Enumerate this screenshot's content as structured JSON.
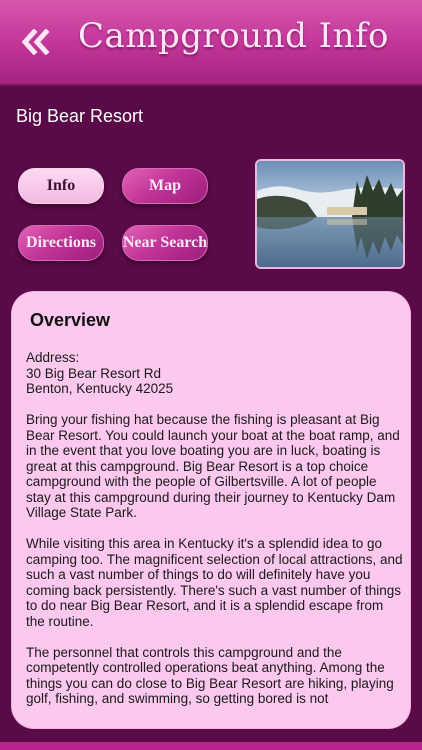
{
  "header": {
    "title": "Campground Info",
    "back_icon": "double-chevron-left-icon"
  },
  "resort": {
    "name": "Big Bear Resort"
  },
  "buttons": {
    "info": "Info",
    "map": "Map",
    "directions": "Directions",
    "near_search": "Near Search"
  },
  "photo": {
    "alt": "Lake view with snowy hills"
  },
  "overview": {
    "title": "Overview",
    "address_label": "Address:",
    "address_line1": "30 Big Bear Resort Rd",
    "address_line2": "Benton, Kentucky 42025",
    "paragraphs": [
      "Bring your fishing hat because the fishing is pleasant at Big Bear Resort. You could launch your boat at the boat ramp, and in the event that you love boating you are in luck, boating is great at this campground. Big Bear Resort is a top choice campground with the people of Gilbertsville. A lot of people stay at this campground during their journey to Kentucky Dam Village State Park.",
      "While visiting this area in Kentucky it's a splendid idea to go camping too. The magnificent selection of local attractions, and such a vast number of things to do will definitely have you coming back persistently. There's such a vast number of things to do near Big Bear Resort, and it is a splendid escape from the routine.",
      "The personnel that controls this campground and the competently controlled operations beat anything. Among the things you can do close to Big Bear Resort are hiking, playing golf, fishing, and swimming, so getting bored is not"
    ]
  },
  "colors": {
    "background": "#5a0a48",
    "header": "#c3379a",
    "panel": "#fcc8ee",
    "accent": "#b6248c"
  }
}
